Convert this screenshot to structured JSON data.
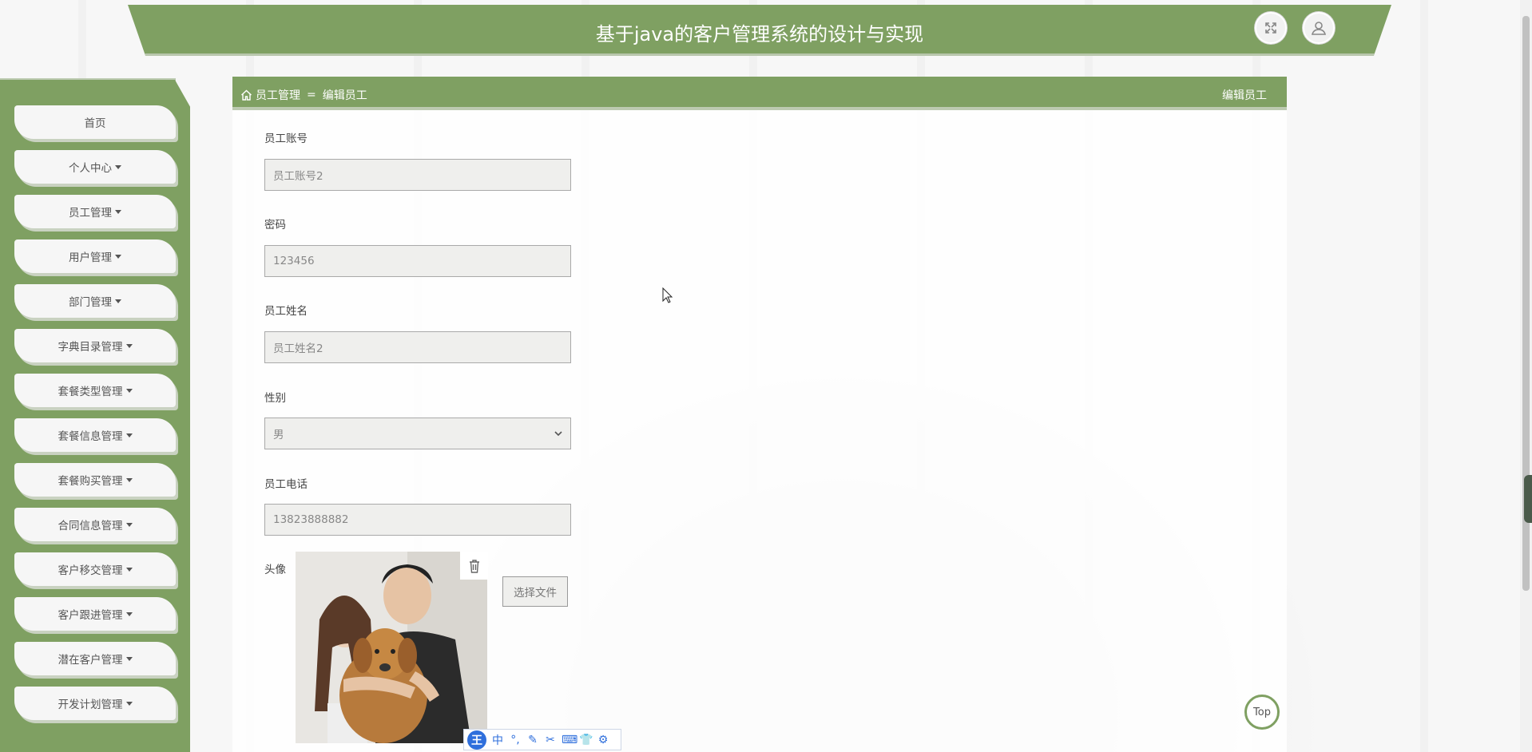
{
  "app": {
    "title": "基于java的客户管理系统的设计与实现"
  },
  "header": {
    "fullscreen_icon": "fullscreen-icon",
    "user_icon": "user-avatar-icon"
  },
  "sidebar": {
    "items": [
      {
        "label": "首页",
        "has_caret": false
      },
      {
        "label": "个人中心",
        "has_caret": true
      },
      {
        "label": "员工管理",
        "has_caret": true
      },
      {
        "label": "用户管理",
        "has_caret": true
      },
      {
        "label": "部门管理",
        "has_caret": true
      },
      {
        "label": "字典目录管理",
        "has_caret": true
      },
      {
        "label": "套餐类型管理",
        "has_caret": true
      },
      {
        "label": "套餐信息管理",
        "has_caret": true
      },
      {
        "label": "套餐购买管理",
        "has_caret": true
      },
      {
        "label": "合同信息管理",
        "has_caret": true
      },
      {
        "label": "客户移交管理",
        "has_caret": true
      },
      {
        "label": "客户跟进管理",
        "has_caret": true
      },
      {
        "label": "潜在客户管理",
        "has_caret": true
      },
      {
        "label": "开发计划管理",
        "has_caret": true
      }
    ]
  },
  "breadcrumb": {
    "home_icon": "home-icon",
    "section": "员工管理",
    "separator": "=",
    "current": "编辑员工",
    "right_title": "编辑员工"
  },
  "form": {
    "account": {
      "label": "员工账号",
      "value": "员工账号2"
    },
    "password": {
      "label": "密码",
      "value": "123456"
    },
    "name": {
      "label": "员工姓名",
      "value": "员工姓名2"
    },
    "gender": {
      "label": "性别",
      "value": "男"
    },
    "phone": {
      "label": "员工电话",
      "value": "13823888882"
    },
    "avatar": {
      "label": "头像",
      "choose_file": "选择文件"
    }
  },
  "top_button": {
    "label": "Top"
  },
  "ime_toolbar": {
    "logo": "王",
    "items": [
      "中",
      "°,",
      "✎",
      "✂",
      "⌨",
      "👕",
      "⚙"
    ]
  }
}
